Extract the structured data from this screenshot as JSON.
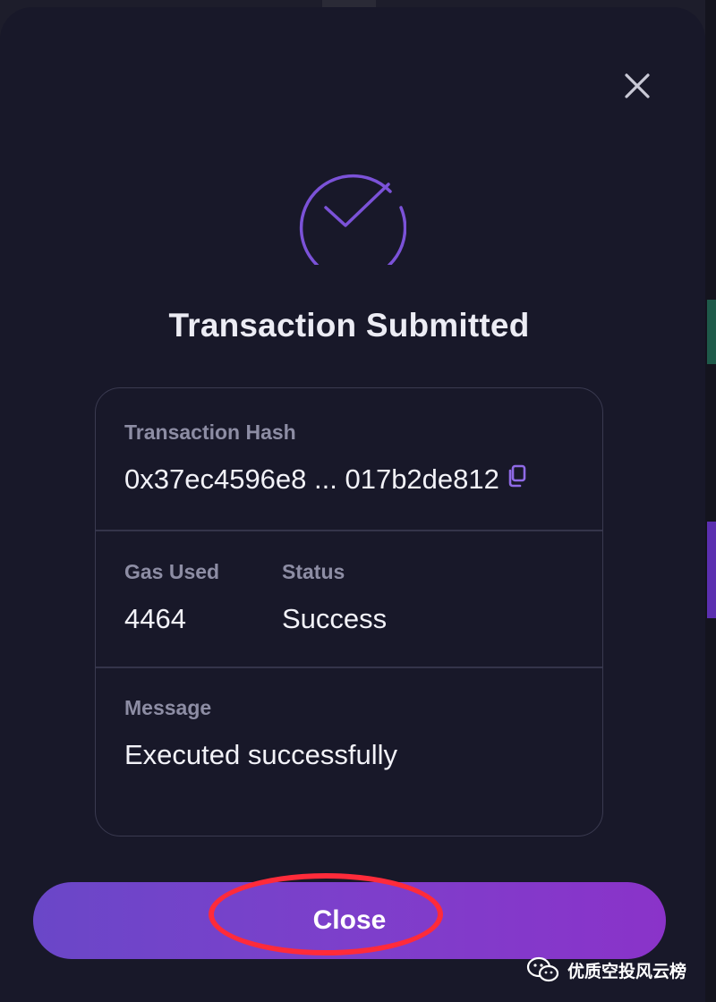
{
  "modal": {
    "title": "Transaction Submitted",
    "close_icon": "close-icon",
    "status_icon": "check-circle-icon",
    "accent_color": "#7b52d8"
  },
  "details": {
    "hash_label": "Transaction Hash",
    "hash_value": "0x37ec4596e8 ... 017b2de812",
    "copy_icon": "copy-icon",
    "gas_label": "Gas Used",
    "gas_value": "4464",
    "status_label": "Status",
    "status_value": "Success",
    "message_label": "Message",
    "message_value": "Executed successfully"
  },
  "footer": {
    "close_label": "Close",
    "annotation_color": "#ff2b3a"
  },
  "watermark": {
    "text": "优质空投风云榜",
    "icon": "wechat-icon"
  }
}
